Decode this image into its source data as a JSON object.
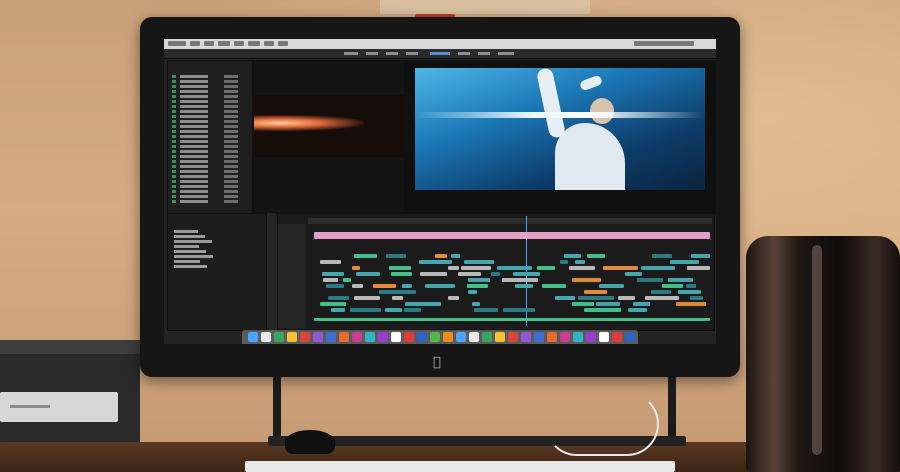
{
  "scene": {
    "description_tag": "",
    "colors": {
      "wall": "#c9a179",
      "bezel": "#161616",
      "program_frame_sky": "#1c79b8",
      "clip_pink": "#e2a0c6",
      "clip_green": "#43c08a",
      "clip_cyan": "#47a5ad",
      "playhead": "#4aa3ff"
    }
  },
  "icons": {
    "apple_logo": "apple-logo-icon"
  },
  "labels": {
    "apple_glyph": ""
  }
}
